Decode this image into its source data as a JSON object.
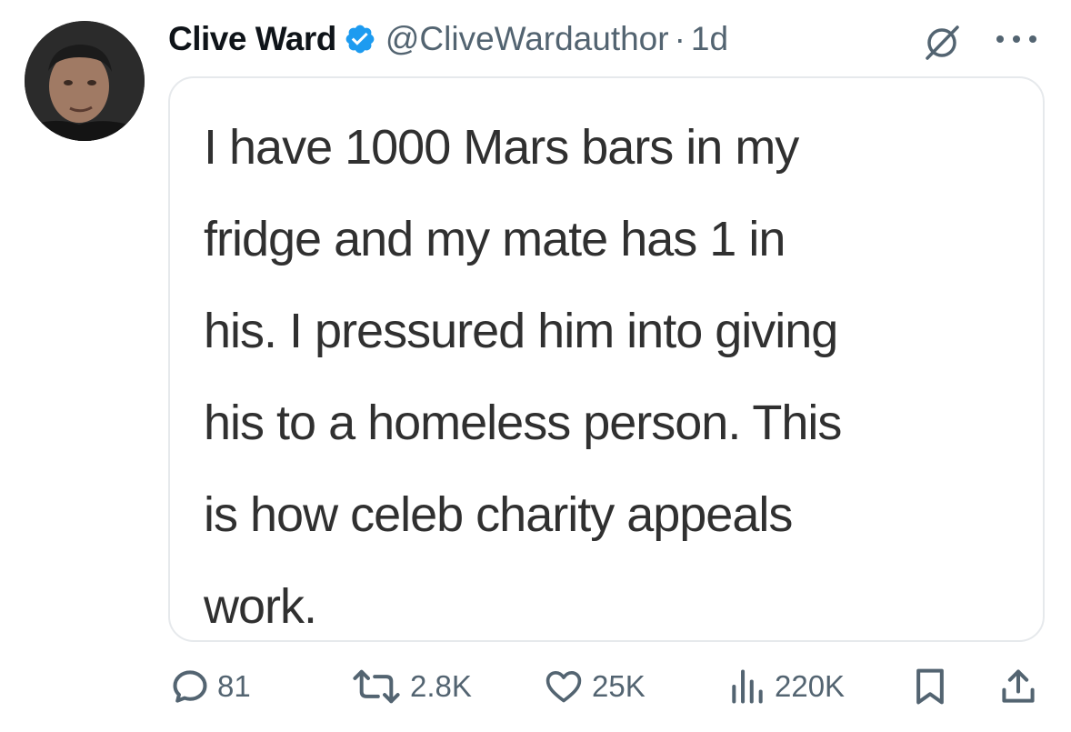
{
  "tweet": {
    "display_name": "Clive Ward",
    "handle": "@CliveWardauthor",
    "separator": "·",
    "time": "1d",
    "verified": true,
    "avatar": "profile-photo"
  },
  "card": {
    "lines": [
      "I have 1000 Mars bars in my",
      "fridge and my mate has 1 in",
      "his. I pressured him into giving",
      "his to a homeless person. This",
      "is how celeb charity appeals",
      "work."
    ]
  },
  "actions": {
    "replies": "81",
    "reposts": "2.8K",
    "likes": "25K",
    "views": "220K"
  },
  "colors": {
    "verified_badge": "#1d9bf0",
    "secondary_text": "#536471",
    "primary_text": "#0f1419",
    "card_border": "#e6e9ec"
  },
  "icons": {
    "grok": "grok-icon",
    "more": "more-icon",
    "reply": "reply-icon",
    "repost": "repost-icon",
    "like": "like-icon",
    "views": "views-icon",
    "bookmark": "bookmark-icon",
    "share": "share-icon"
  }
}
